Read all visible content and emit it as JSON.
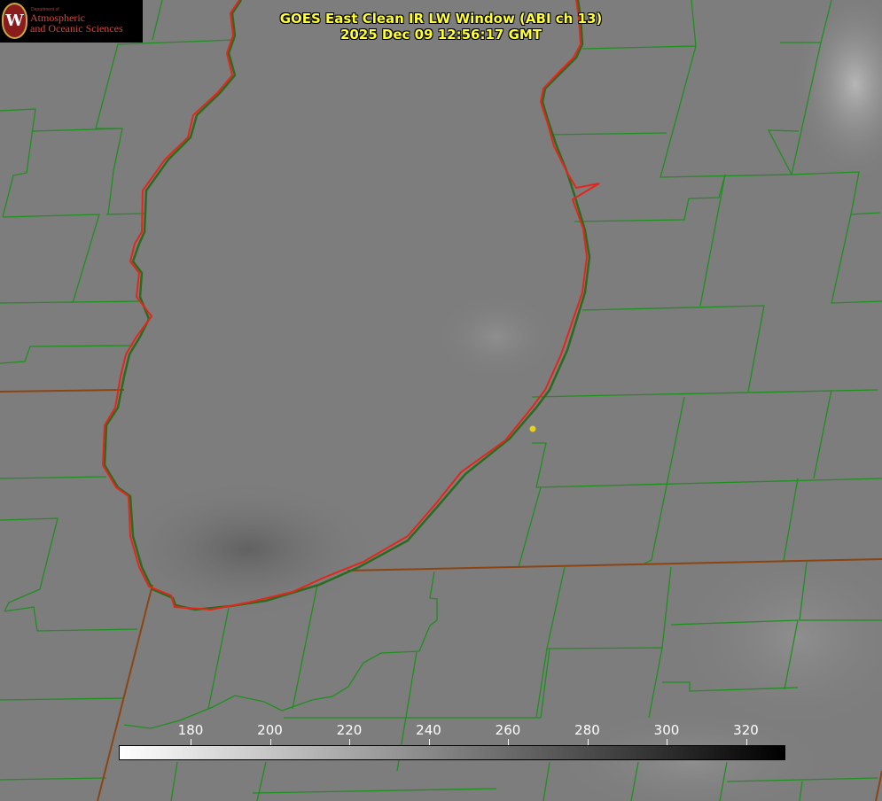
{
  "header": {
    "title_line1": "GOES East Clean IR LW Window (ABI ch 13)",
    "title_line2": "2025 Dec 09 12:56:17 GMT"
  },
  "logo": {
    "department": "Department of",
    "line1": "Atmospheric",
    "line2": "and Oceanic Sciences",
    "seal_letter": "W"
  },
  "colorbar": {
    "ticks": [
      "180",
      "200",
      "220",
      "240",
      "260",
      "280",
      "300",
      "320"
    ],
    "color_low": "#ffffff",
    "color_high": "#000000"
  },
  "map_colors": {
    "county_border": "#1f8f1f",
    "state_border": "#a0522d",
    "lake_shoreline": "#e8241a",
    "marker": "#e6d21a",
    "background_gray": "#7d7d7d"
  }
}
